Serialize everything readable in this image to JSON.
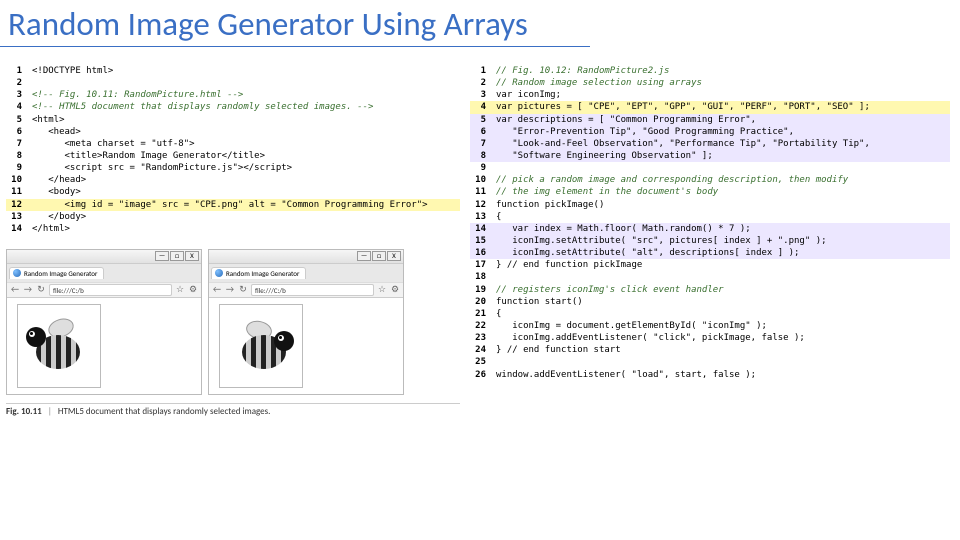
{
  "title": "Random Image Generator Using Arrays",
  "left": {
    "lines": [
      {
        "n": "1",
        "cls": "",
        "t": "<!DOCTYPE html>"
      },
      {
        "n": "2",
        "cls": "",
        "t": ""
      },
      {
        "n": "3",
        "cls": "c-comment",
        "t": "<!-- Fig. 10.11: RandomPicture.html -->"
      },
      {
        "n": "4",
        "cls": "c-comment",
        "t": "<!-- HTML5 document that displays randomly selected images. -->"
      },
      {
        "n": "5",
        "cls": "",
        "t": "<html>"
      },
      {
        "n": "6",
        "cls": "",
        "t": "   <head>"
      },
      {
        "n": "7",
        "cls": "",
        "t": "      <meta charset = \"utf-8\">"
      },
      {
        "n": "8",
        "cls": "",
        "t": "      <title>Random Image Generator</title>"
      },
      {
        "n": "9",
        "cls": "",
        "t": "      <script src = \"RandomPicture.js\"></script>"
      },
      {
        "n": "10",
        "cls": "",
        "t": "   </head>"
      },
      {
        "n": "11",
        "cls": "",
        "t": "   <body>"
      },
      {
        "n": "12",
        "cls": "hl-line",
        "t": "      <img id = \"image\" src = \"CPE.png\" alt = \"Common Programming Error\">"
      },
      {
        "n": "13",
        "cls": "",
        "t": "   </body>"
      },
      {
        "n": "14",
        "cls": "",
        "t": "</html>"
      }
    ]
  },
  "browsers": {
    "tab_title": "Random Image Generator",
    "addr": "file:///C:/b",
    "win": {
      "min": "—",
      "max": "□",
      "close": "X"
    }
  },
  "left_caption": {
    "label": "Fig. 10.11",
    "sep": "|",
    "text": "HTML5 document that displays randomly selected images."
  },
  "right": {
    "lines": [
      {
        "n": "1",
        "cls": "c-comment",
        "t": "// Fig. 10.12: RandomPicture2.js"
      },
      {
        "n": "2",
        "cls": "c-comment",
        "t": "// Random image selection using arrays"
      },
      {
        "n": "3",
        "cls": "",
        "t": "var iconImg;"
      },
      {
        "n": "4",
        "cls": "hl-line",
        "t": "var pictures = [ \"CPE\", \"EPT\", \"GPP\", \"GUI\", \"PERF\", \"PORT\", \"SEO\" ];"
      },
      {
        "n": "5",
        "cls": "hl2-line",
        "t": "var descriptions = [ \"Common Programming Error\","
      },
      {
        "n": "6",
        "cls": "hl2-line",
        "t": "   \"Error-Prevention Tip\", \"Good Programming Practice\","
      },
      {
        "n": "7",
        "cls": "hl2-line",
        "t": "   \"Look-and-Feel Observation\", \"Performance Tip\", \"Portability Tip\","
      },
      {
        "n": "8",
        "cls": "hl2-line",
        "t": "   \"Software Engineering Observation\" ];"
      },
      {
        "n": "9",
        "cls": "",
        "t": ""
      },
      {
        "n": "10",
        "cls": "c-comment",
        "t": "// pick a random image and corresponding description, then modify"
      },
      {
        "n": "11",
        "cls": "c-comment",
        "t": "// the img element in the document's body"
      },
      {
        "n": "12",
        "cls": "",
        "t": "function pickImage()"
      },
      {
        "n": "13",
        "cls": "",
        "t": "{"
      },
      {
        "n": "14",
        "cls": "hl2-line",
        "t": "   var index = Math.floor( Math.random() * 7 );"
      },
      {
        "n": "15",
        "cls": "hl2-line",
        "t": "   iconImg.setAttribute( \"src\", pictures[ index ] + \".png\" );"
      },
      {
        "n": "16",
        "cls": "hl2-line",
        "t": "   iconImg.setAttribute( \"alt\", descriptions[ index ] );"
      },
      {
        "n": "17",
        "cls": "",
        "t": "} // end function pickImage"
      },
      {
        "n": "18",
        "cls": "",
        "t": ""
      },
      {
        "n": "19",
        "cls": "c-comment",
        "t": "// registers iconImg's click event handler"
      },
      {
        "n": "20",
        "cls": "",
        "t": "function start()"
      },
      {
        "n": "21",
        "cls": "",
        "t": "{"
      },
      {
        "n": "22",
        "cls": "",
        "t": "   iconImg = document.getElementById( \"iconImg\" );"
      },
      {
        "n": "23",
        "cls": "",
        "t": "   iconImg.addEventListener( \"click\", pickImage, false );"
      },
      {
        "n": "24",
        "cls": "",
        "t": "} // end function start"
      },
      {
        "n": "25",
        "cls": "",
        "t": ""
      },
      {
        "n": "26",
        "cls": "",
        "t": "window.addEventListener( \"load\", start, false );"
      }
    ]
  }
}
